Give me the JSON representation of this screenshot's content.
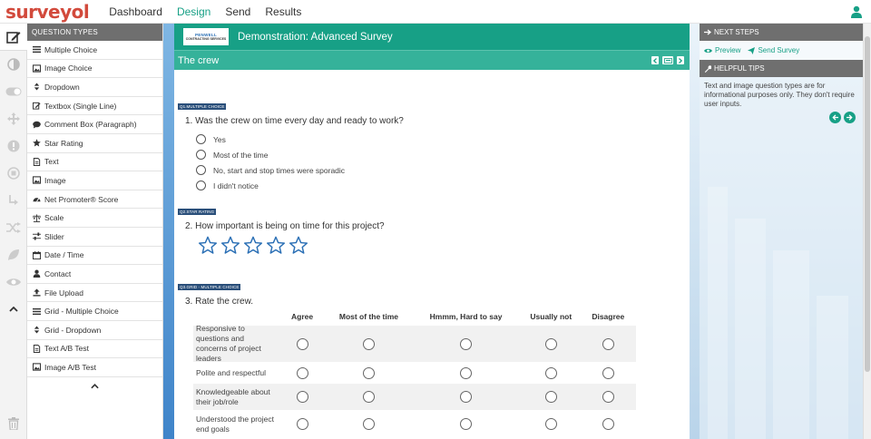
{
  "app": {
    "logo": "surveyol"
  },
  "nav": {
    "items": [
      "Dashboard",
      "Design",
      "Send",
      "Results"
    ],
    "active": "Design"
  },
  "question_types": {
    "header": "Question Types",
    "items": [
      {
        "label": "Multiple Choice",
        "icon": "list-icon"
      },
      {
        "label": "Image Choice",
        "icon": "image-icon"
      },
      {
        "label": "Dropdown",
        "icon": "sort-icon"
      },
      {
        "label": "Textbox (Single Line)",
        "icon": "pencil-icon"
      },
      {
        "label": "Comment Box (Paragraph)",
        "icon": "comment-icon"
      },
      {
        "label": "Star Rating",
        "icon": "star-icon"
      },
      {
        "label": "Text",
        "icon": "document-icon"
      },
      {
        "label": "Image",
        "icon": "image-icon"
      },
      {
        "label": "Net Promoter® Score",
        "icon": "gauge-icon"
      },
      {
        "label": "Scale",
        "icon": "scale-icon"
      },
      {
        "label": "Slider",
        "icon": "slider-icon"
      },
      {
        "label": "Date / Time",
        "icon": "calendar-icon"
      },
      {
        "label": "Contact",
        "icon": "user-icon"
      },
      {
        "label": "File Upload",
        "icon": "upload-icon"
      },
      {
        "label": "Grid - Multiple Choice",
        "icon": "list-icon"
      },
      {
        "label": "Grid - Dropdown",
        "icon": "sort-icon"
      },
      {
        "label": "Text A/B Test",
        "icon": "document-icon"
      },
      {
        "label": "Image A/B Test",
        "icon": "image-icon"
      }
    ]
  },
  "survey": {
    "company_logo": {
      "line1": "PENWELL",
      "line2": "CONTRACTING SERVICES"
    },
    "title": "Demonstration: Advanced Survey",
    "page_title": "The crew",
    "q1": {
      "tag": "Q1.Multiple Choice",
      "text": "1. Was the crew on time every day and ready to work?",
      "options": [
        "Yes",
        "Most of the time",
        "No, start and stop times were sporadic",
        "I didn't notice"
      ]
    },
    "q2": {
      "tag": "Q2.Star Rating",
      "text": "2. How important is being on time for this project?",
      "stars": 5
    },
    "q3": {
      "tag": "Q3.Grid - Multiple Choice",
      "text": "3. Rate the crew.",
      "columns": [
        "Agree",
        "Most of the time",
        "Hmmm, Hard to say",
        "Usually not",
        "Disagree"
      ],
      "rows": [
        "Responsive to questions and concerns of project leaders",
        "Polite and respectful",
        "Knowledgeable about their job/role",
        "Understood the project end goals"
      ]
    }
  },
  "right_panel": {
    "next_steps_header": "Next Steps",
    "preview_label": "Preview",
    "send_label": "Send Survey",
    "tips_header": "Helpful Tips",
    "tip_text": "Text and image question types are for informational purposes only. They don't require user inputs."
  },
  "colors": {
    "brand_red": "#d24a3c",
    "accent_green": "#17a086",
    "panel_gray": "#6f6f6f",
    "tag_blue": "#2a4f7a"
  }
}
